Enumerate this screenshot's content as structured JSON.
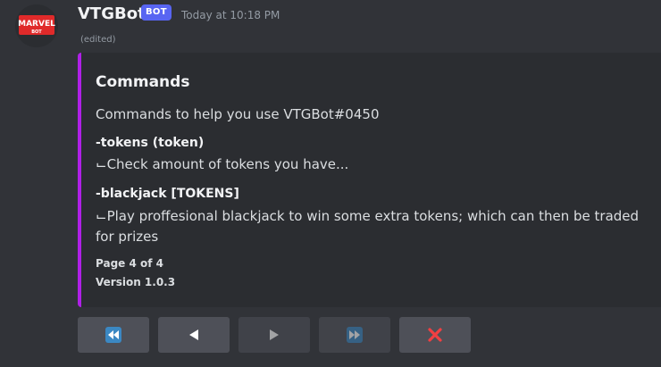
{
  "message": {
    "username": "VTGBot",
    "bot_tag": "BOT",
    "timestamp": "Today at 10:18 PM",
    "edited": "(edited)",
    "avatar_text_top": "MARVEL",
    "avatar_text_bottom": "BOT"
  },
  "embed": {
    "accent_color": "#b020e8",
    "title": "Commands",
    "description": "Commands to help you use VTGBot#0450",
    "fields": [
      {
        "name": "-tokens (token)",
        "value": "⌙Check amount of tokens you have..."
      },
      {
        "name": "-blackjack [TOKENS]",
        "value": "⌙Play proffesional blackjack to win some extra tokens; which can then be traded for prizes"
      }
    ],
    "footer_page": "Page 4 of 4",
    "footer_version": "Version 1.0.3"
  },
  "buttons": [
    {
      "icon": "rewind-icon",
      "enabled": true
    },
    {
      "icon": "triangle-left-icon",
      "enabled": true
    },
    {
      "icon": "triangle-right-icon",
      "enabled": false
    },
    {
      "icon": "fast-forward-icon",
      "enabled": false
    },
    {
      "icon": "close-icon",
      "enabled": true,
      "color": "#f23f42"
    }
  ]
}
